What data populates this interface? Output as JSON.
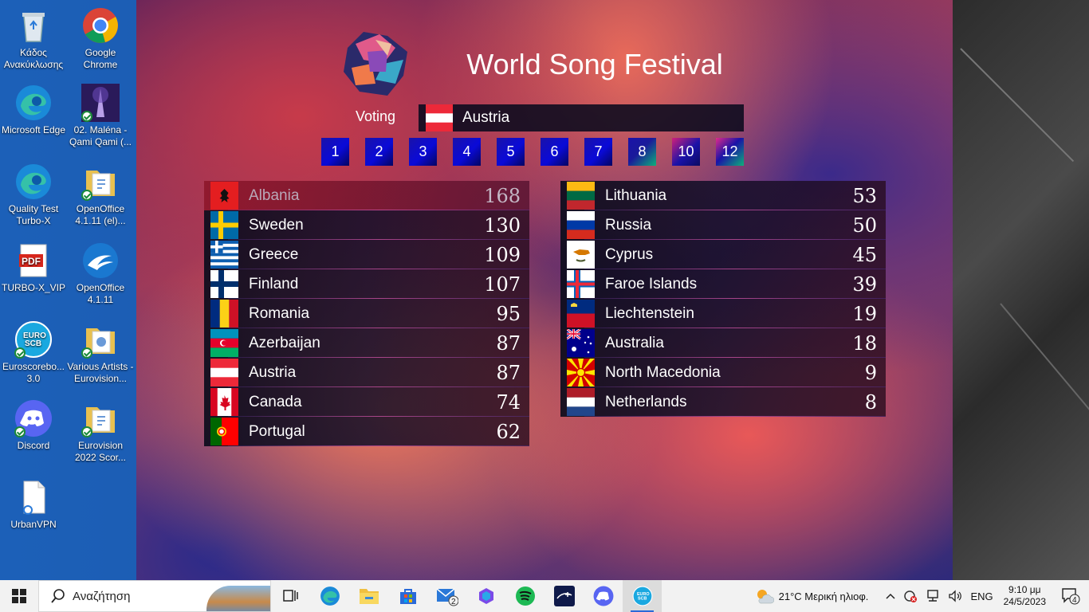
{
  "desktop": {
    "icons": [
      {
        "label": "Κάδος Ανακύκλωσης"
      },
      {
        "label": "Google Chrome"
      },
      {
        "label": "Microsoft Edge"
      },
      {
        "label": "02. Maléna - Qami Qami (..."
      },
      {
        "label": "Quality Test Turbo-X"
      },
      {
        "label": "OpenOffice 4.1.11 (el)..."
      },
      {
        "label": "TURBO-X_VIP"
      },
      {
        "label": "OpenOffice 4.1.11"
      },
      {
        "label": "Euroscorebo... 3.0"
      },
      {
        "label": "Various Artists - Eurovision..."
      },
      {
        "label": "Discord"
      },
      {
        "label": "Eurovision 2022 Scor..."
      },
      {
        "label": "UrbanVPN"
      }
    ]
  },
  "app": {
    "title": "World Song Festival",
    "voting_label": "Voting",
    "current_voter": {
      "country": "Austria"
    },
    "points": [
      "1",
      "2",
      "3",
      "4",
      "5",
      "6",
      "7",
      "8",
      "10",
      "12"
    ],
    "scoreboard_left": [
      {
        "country": "Albania",
        "score": "168"
      },
      {
        "country": "Sweden",
        "score": "130"
      },
      {
        "country": "Greece",
        "score": "109"
      },
      {
        "country": "Finland",
        "score": "107"
      },
      {
        "country": "Romania",
        "score": "95"
      },
      {
        "country": "Azerbaijan",
        "score": "87"
      },
      {
        "country": "Austria",
        "score": "87"
      },
      {
        "country": "Canada",
        "score": "74"
      },
      {
        "country": "Portugal",
        "score": "62"
      }
    ],
    "scoreboard_right": [
      {
        "country": "Lithuania",
        "score": "53"
      },
      {
        "country": "Russia",
        "score": "50"
      },
      {
        "country": "Cyprus",
        "score": "45"
      },
      {
        "country": "Faroe Islands",
        "score": "39"
      },
      {
        "country": "Liechtenstein",
        "score": "19"
      },
      {
        "country": "Australia",
        "score": "18"
      },
      {
        "country": "North Macedonia",
        "score": "9"
      },
      {
        "country": "Netherlands",
        "score": "8"
      }
    ]
  },
  "taskbar": {
    "search_placeholder": "Αναζήτηση",
    "mail_badge": "2",
    "weather": "21°C  Μερική ηλιοφ.",
    "language": "ENG",
    "time": "9:10 μμ",
    "date": "24/5/2023",
    "notifications": "4"
  }
}
